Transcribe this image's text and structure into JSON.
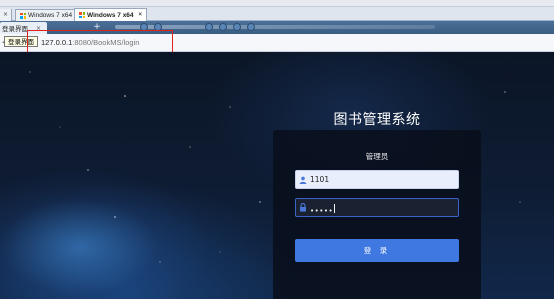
{
  "vm_tabs": {
    "items": [
      {
        "label": "Windows 7 x64",
        "active": false
      },
      {
        "label": "Windows 7 x64",
        "active": true
      }
    ],
    "close_glyph": "×"
  },
  "guest_browser": {
    "tab": {
      "label": "登录界面"
    },
    "tooltip": "登录界面",
    "new_tab_glyph": "+",
    "address": {
      "host": "127.0.0.1",
      "path": ":8080/BookMS/login"
    }
  },
  "page": {
    "title": "图书管理系统",
    "role_label": "管理员",
    "username_value": "1101",
    "password_masked": "•••••",
    "login_button": "登 录"
  },
  "colors": {
    "accent": "#3f78e0",
    "highlight_box": "#e0201b",
    "card_bg": "#080e1a"
  },
  "icons": [
    "windows-icon",
    "info-icon",
    "user-icon",
    "lock-icon",
    "close-icon"
  ]
}
